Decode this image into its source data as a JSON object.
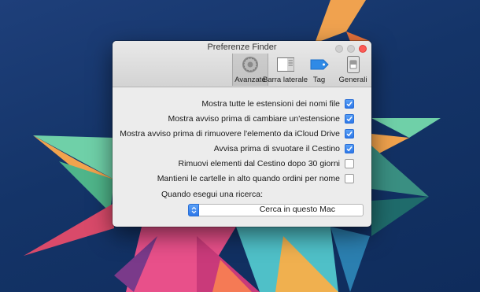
{
  "window": {
    "title": "Preferenze Finder"
  },
  "toolbar": {
    "tabs": [
      {
        "label": "Avanzate",
        "icon": "gear-icon",
        "selected": true
      },
      {
        "label": "Barra laterale",
        "icon": "sidebar-icon",
        "selected": false
      },
      {
        "label": "Tag",
        "icon": "tag-icon",
        "selected": false
      },
      {
        "label": "Generali",
        "icon": "switch-icon",
        "selected": false
      }
    ]
  },
  "options": [
    {
      "label": "Mostra tutte le estensioni dei nomi file",
      "checked": true
    },
    {
      "label": "Mostra avviso prima di cambiare un'estensione",
      "checked": true
    },
    {
      "label": "Mostra avviso prima di rimuovere l'elemento da iCloud Drive",
      "checked": true
    },
    {
      "label": "Avvisa prima di svuotare il Cestino",
      "checked": true
    },
    {
      "label": "Rimuovi elementi dal Cestino dopo 30 giorni",
      "checked": false
    },
    {
      "label": "Mantieni le cartelle in alto quando ordini per nome",
      "checked": false
    }
  ],
  "search": {
    "label": "Quando esegui una ricerca:",
    "selected_value": "Cerca in questo Mac"
  },
  "colors": {
    "accent": "#2c77e9",
    "close": "#fc5b57",
    "tag": "#2f8ae6"
  }
}
